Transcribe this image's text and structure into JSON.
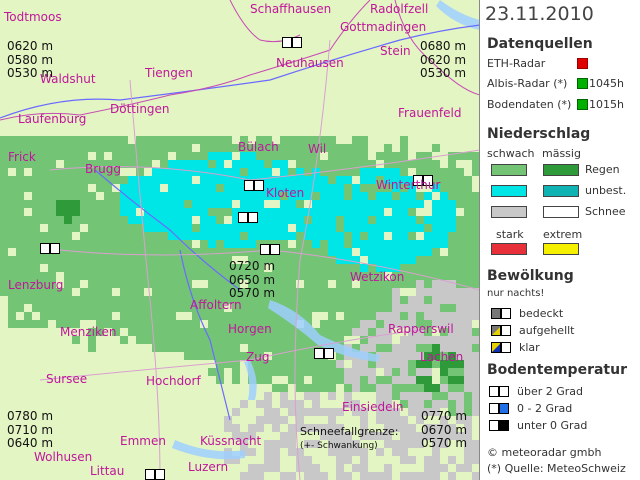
{
  "date": "23.11.2010",
  "data_sources": {
    "title": "Datenquellen",
    "items": [
      {
        "label": "ETH-Radar",
        "status_color": "#e00000",
        "time": ""
      },
      {
        "label": "Albis-Radar (*)",
        "status_color": "#00b000",
        "time": "1045h"
      },
      {
        "label": "Bodendaten (*)",
        "status_color": "#00b000",
        "time": "1015h"
      }
    ]
  },
  "precipitation": {
    "title": "Niederschlag",
    "col_weak": "schwach",
    "col_moderate": "mässig",
    "rows": [
      {
        "label": "Regen",
        "weak_color": "#74c476",
        "moderate_color": "#2e9a3a"
      },
      {
        "label": "unbest.",
        "weak_color": "#00e5e5",
        "moderate_color": "#10b3b3"
      },
      {
        "label": "Schnee",
        "weak_color": "#c8c8c8",
        "moderate_color": "#ffffff"
      }
    ],
    "col_strong": "stark",
    "col_extreme": "extrem",
    "strong_color": "#e8303a",
    "extreme_color": "#f4f000"
  },
  "cloudiness": {
    "title": "Bewölkung",
    "subtitle": "nur nachts!",
    "items": [
      "bedeckt",
      "aufgehellt",
      "klar"
    ]
  },
  "ground_temperature": {
    "title": "Bodentemperatur",
    "items": [
      "über 2 Grad",
      "0 - 2 Grad",
      "unter 0 Grad"
    ]
  },
  "credits": [
    "© meteoradar gmbh",
    "(*) Quelle: MeteoSchweiz"
  ],
  "towns": [
    "Todtmoos",
    "Schaffhausen",
    "Radolfzell",
    "Gottmadingen",
    "Stein",
    "Waldshut",
    "Tiengen",
    "Neuhausen",
    "Döttingen",
    "Laufenburg",
    "Frauenfeld",
    "Bülach",
    "Frick",
    "Brugg",
    "Wil",
    "Kloten",
    "Wetzikon",
    "Winterthur",
    "Rapperswil",
    "Lenzburg",
    "Affoltern",
    "Horgen",
    "Lachen",
    "Menziken",
    "Sursee",
    "Hochdorf",
    "Zug",
    "Einsiedeln",
    "Emmen",
    "Küssnacht",
    "Wolhusen",
    "Luzern",
    "Littau"
  ],
  "altitudes": {
    "top_left": [
      "0620 m",
      "0580 m",
      "0530 m"
    ],
    "top_right": [
      "0680 m",
      "0620 m",
      "0530 m"
    ],
    "center": [
      "0720 m",
      "0650 m",
      "0570 m"
    ],
    "bottom_left": [
      "0780 m",
      "0710 m",
      "0640 m"
    ],
    "bottom_right": [
      "0770 m",
      "0670 m",
      "0570 m"
    ]
  },
  "snowline": {
    "label": "Schneefallgrenze:",
    "fluct": "(+- Schwankung)"
  }
}
